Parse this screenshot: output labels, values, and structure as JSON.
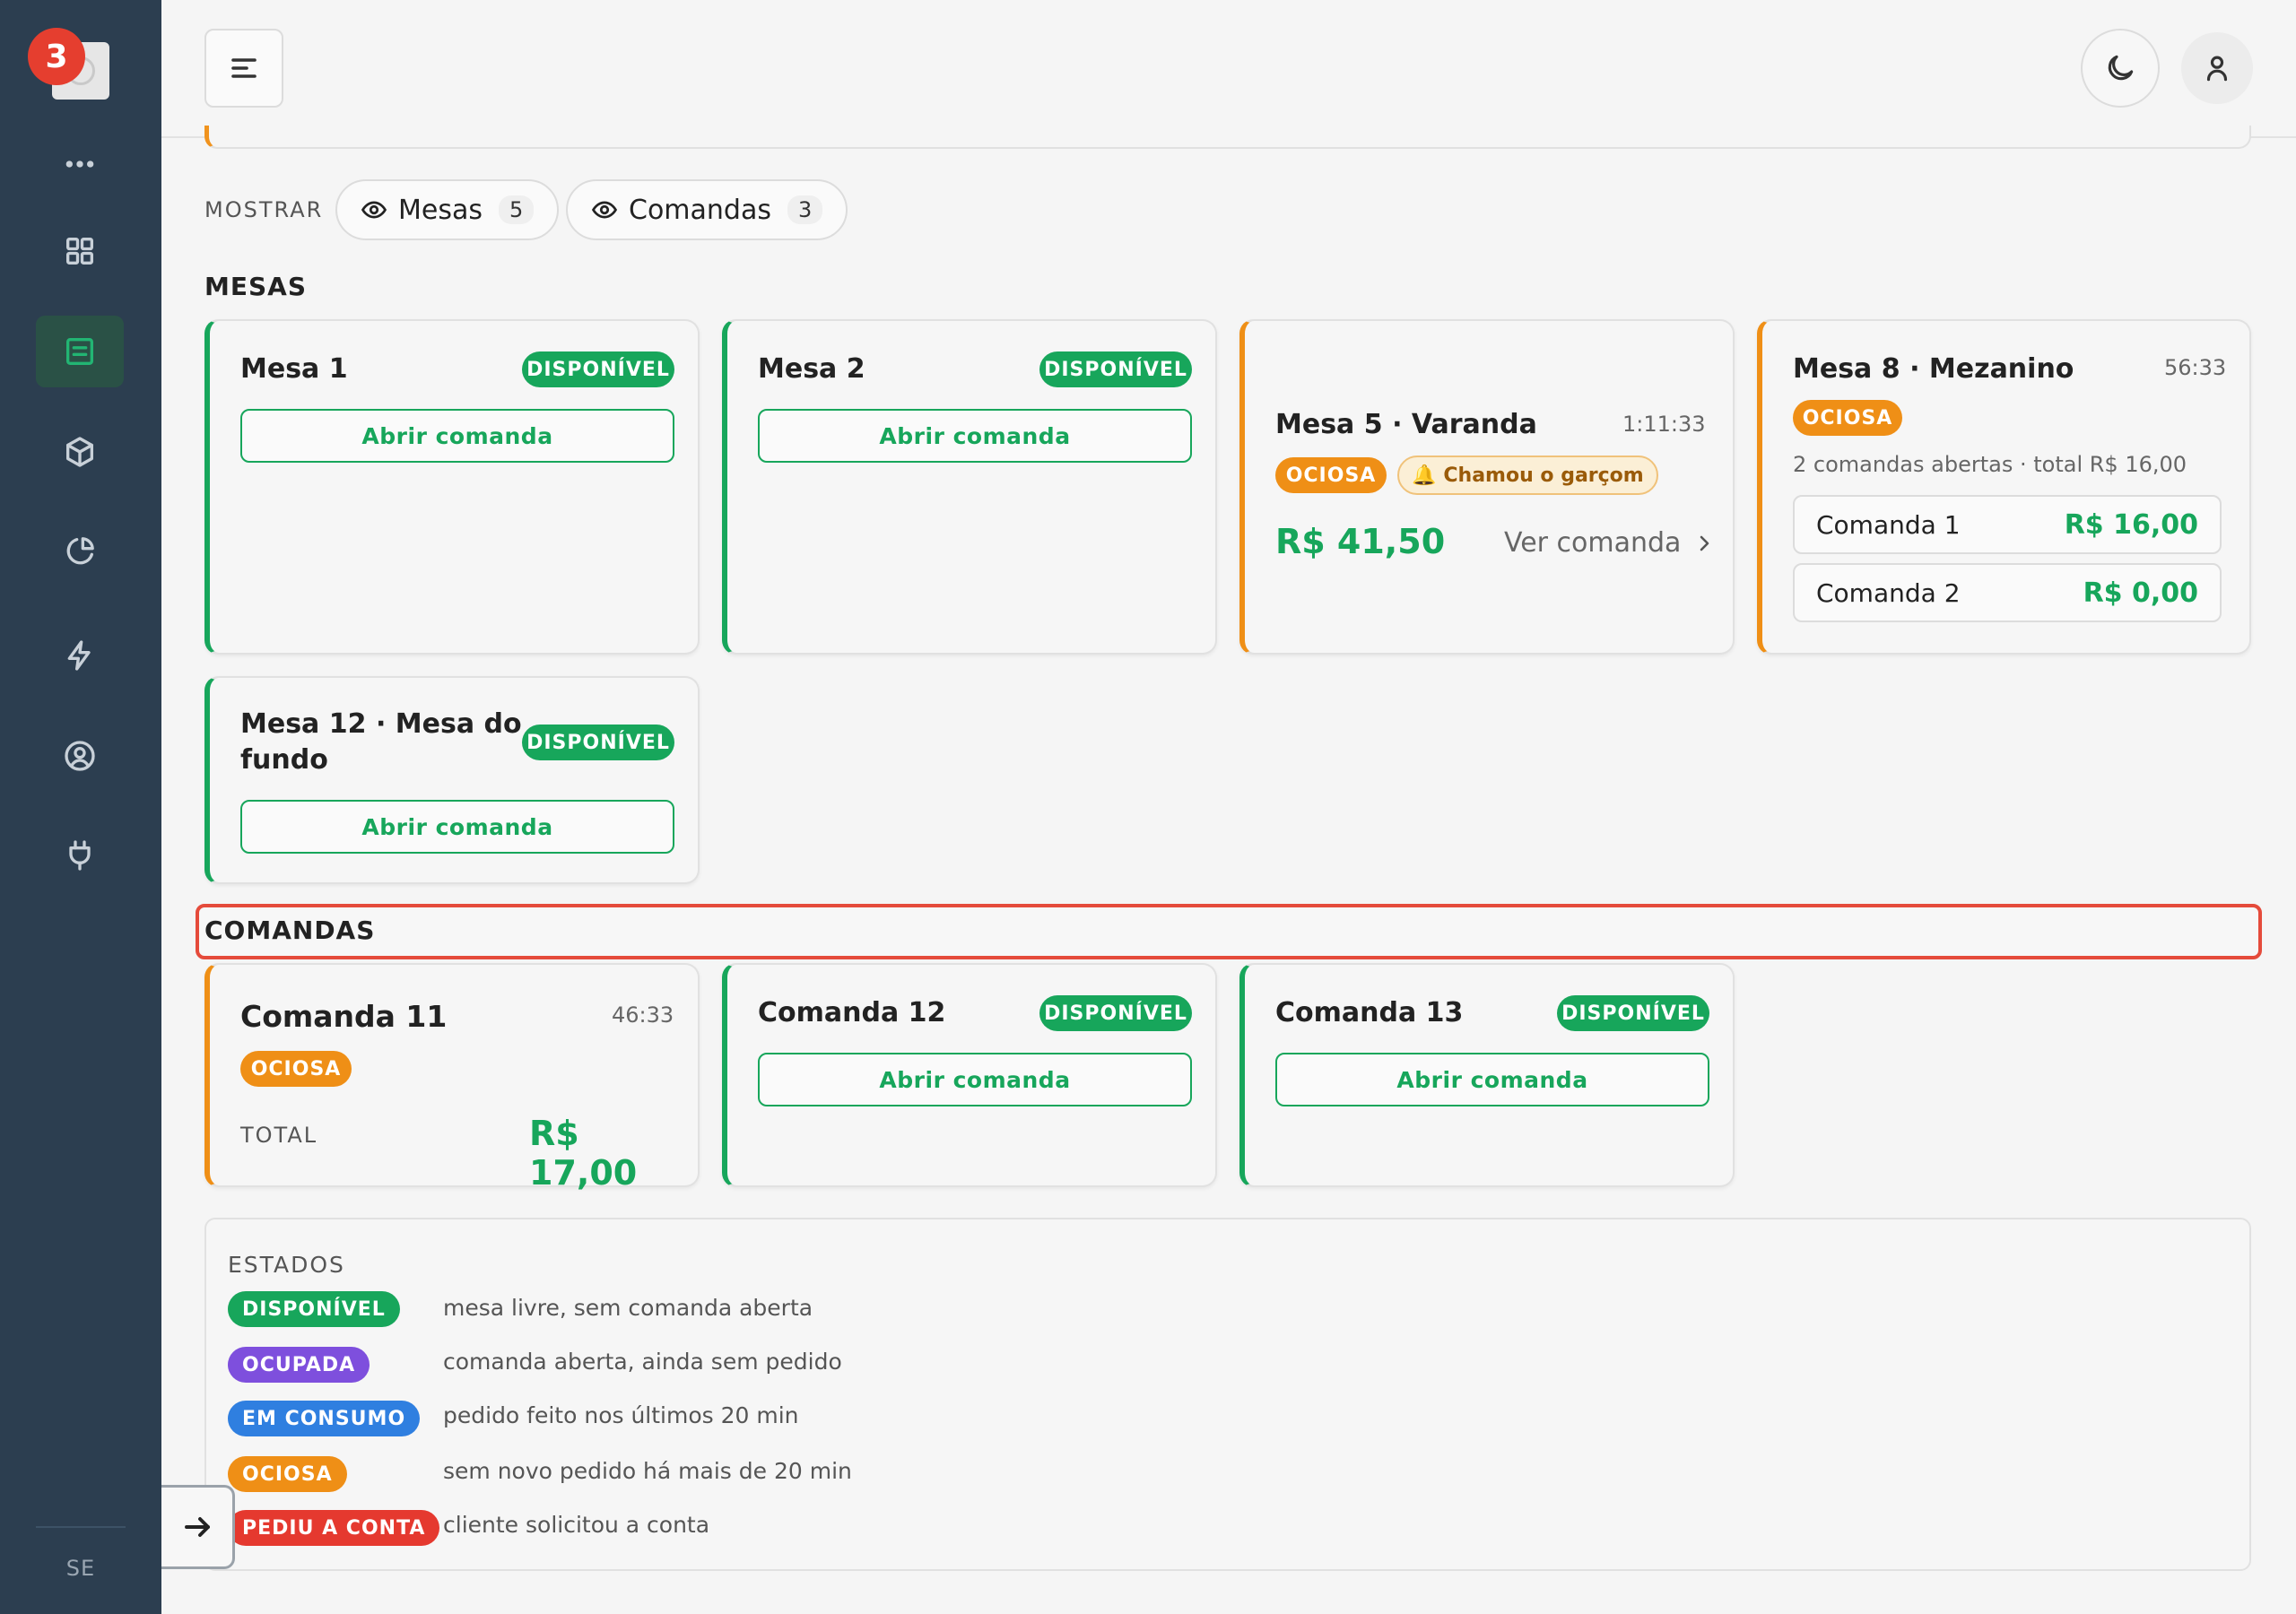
{
  "sidebar": {
    "notification_count": "3",
    "footer_label": "SE",
    "icons": [
      "more-icon",
      "grid-icon",
      "list-icon",
      "box-icon",
      "pie-chart-icon",
      "bolt-icon",
      "user-circle-icon",
      "plug-icon"
    ]
  },
  "filters": {
    "label": "MOSTRAR",
    "mesas": {
      "label": "Mesas",
      "count": "5"
    },
    "comandas": {
      "label": "Comandas",
      "count": "3"
    }
  },
  "sections": {
    "mesas_title": "MESAS",
    "comandas_title": "COMANDAS"
  },
  "mesas": [
    {
      "name": "Mesa 1",
      "status": "DISPONÍVEL",
      "action": "Abrir comanda"
    },
    {
      "name": "Mesa 2",
      "status": "DISPONÍVEL",
      "action": "Abrir comanda"
    },
    {
      "name": "Mesa 5 · Varanda",
      "timer": "1:11:33",
      "status": "OCIOSA",
      "alert": "Chamou o garçom",
      "price": "R$ 41,50",
      "link": "Ver comanda"
    },
    {
      "name": "Mesa 8 · Mezanino",
      "timer": "56:33",
      "status": "OCIOSA",
      "summary": "2 comandas abertas · total R$ 16,00",
      "comandas": [
        {
          "name": "Comanda 1",
          "price": "R$ 16,00"
        },
        {
          "name": "Comanda 2",
          "price": "R$ 0,00"
        }
      ]
    },
    {
      "name_line1": "Mesa 12 · Mesa do",
      "name_line2": "fundo",
      "status": "DISPONÍVEL",
      "action": "Abrir comanda"
    }
  ],
  "comandas": [
    {
      "name": "Comanda 11",
      "timer": "46:33",
      "status": "OCIOSA",
      "total_label": "TOTAL",
      "total": "R$ 17,00"
    },
    {
      "name": "Comanda 12",
      "status": "DISPONÍVEL",
      "action": "Abrir comanda"
    },
    {
      "name": "Comanda 13",
      "status": "DISPONÍVEL",
      "action": "Abrir comanda"
    }
  ],
  "legend": {
    "title": "ESTADOS",
    "items": [
      {
        "badge": "DISPONÍVEL",
        "desc": "mesa livre, sem comanda aberta",
        "color": "#17a65b"
      },
      {
        "badge": "OCUPADA",
        "desc": "comanda aberta, ainda sem pedido",
        "color": "#7e4fdd"
      },
      {
        "badge": "EM CONSUMO",
        "desc": "pedido feito nos últimos 20 min",
        "color": "#2f7fe0"
      },
      {
        "badge": "OCIOSA",
        "desc": "sem novo pedido há mais de 20 min",
        "color": "#ef8f16"
      },
      {
        "badge": "PEDIU A CONTA",
        "desc": "cliente solicitou a conta",
        "color": "#e5392f"
      }
    ]
  }
}
